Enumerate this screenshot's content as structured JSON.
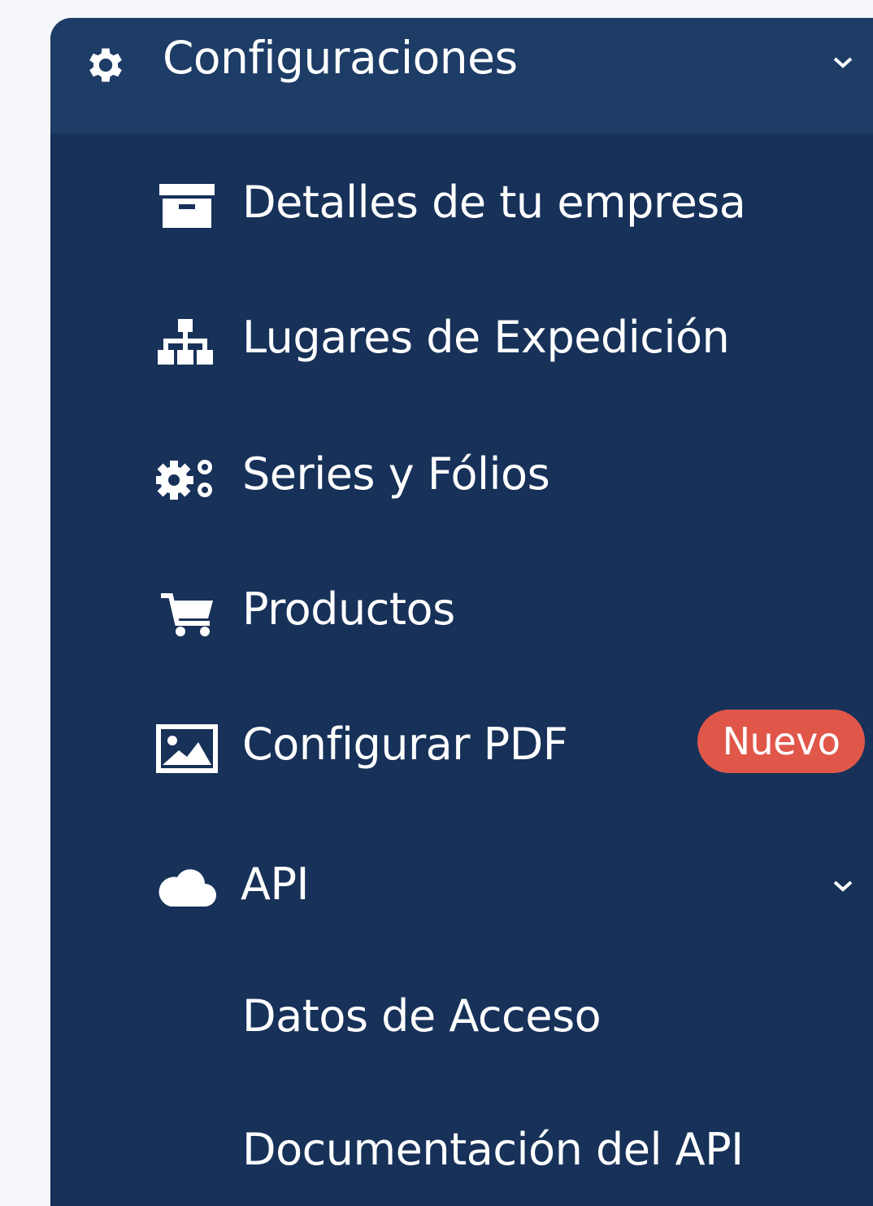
{
  "colors": {
    "sidebar_background": "#173159",
    "header_background": "#1d3c66",
    "badge_background": "#e0574a",
    "text": "#ffffff"
  },
  "section": {
    "title": "Configuraciones",
    "icon": "gear-icon",
    "expanded": true
  },
  "menu": {
    "items": [
      {
        "label": "Detalles de tu empresa",
        "icon": "archive-box-icon"
      },
      {
        "label": "Lugares de Expedición",
        "icon": "sitemap-icon"
      },
      {
        "label": "Series y Fólios",
        "icon": "gears-icon"
      },
      {
        "label": "Productos",
        "icon": "shopping-cart-icon"
      },
      {
        "label": "Configurar PDF",
        "icon": "image-icon",
        "badge": "Nuevo"
      },
      {
        "label": "API",
        "icon": "cloud-icon",
        "expanded": true
      }
    ],
    "api_subitems": [
      {
        "label": "Datos de Acceso"
      },
      {
        "label": "Documentación del API"
      }
    ]
  }
}
